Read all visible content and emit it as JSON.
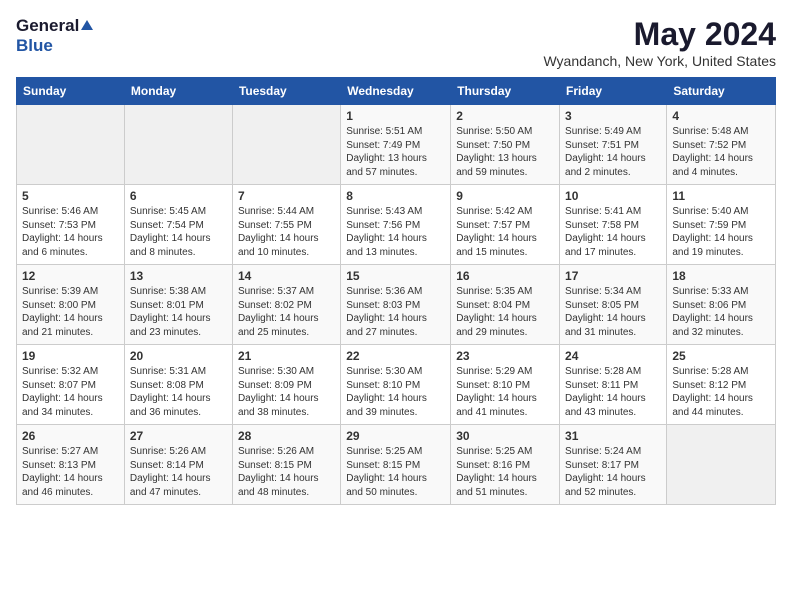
{
  "header": {
    "logo_general": "General",
    "logo_blue": "Blue",
    "month_title": "May 2024",
    "location": "Wyandanch, New York, United States"
  },
  "calendar": {
    "days_of_week": [
      "Sunday",
      "Monday",
      "Tuesday",
      "Wednesday",
      "Thursday",
      "Friday",
      "Saturday"
    ],
    "weeks": [
      [
        {
          "day": "",
          "content": ""
        },
        {
          "day": "",
          "content": ""
        },
        {
          "day": "",
          "content": ""
        },
        {
          "day": "1",
          "content": "Sunrise: 5:51 AM\nSunset: 7:49 PM\nDaylight: 13 hours\nand 57 minutes."
        },
        {
          "day": "2",
          "content": "Sunrise: 5:50 AM\nSunset: 7:50 PM\nDaylight: 13 hours\nand 59 minutes."
        },
        {
          "day": "3",
          "content": "Sunrise: 5:49 AM\nSunset: 7:51 PM\nDaylight: 14 hours\nand 2 minutes."
        },
        {
          "day": "4",
          "content": "Sunrise: 5:48 AM\nSunset: 7:52 PM\nDaylight: 14 hours\nand 4 minutes."
        }
      ],
      [
        {
          "day": "5",
          "content": "Sunrise: 5:46 AM\nSunset: 7:53 PM\nDaylight: 14 hours\nand 6 minutes."
        },
        {
          "day": "6",
          "content": "Sunrise: 5:45 AM\nSunset: 7:54 PM\nDaylight: 14 hours\nand 8 minutes."
        },
        {
          "day": "7",
          "content": "Sunrise: 5:44 AM\nSunset: 7:55 PM\nDaylight: 14 hours\nand 10 minutes."
        },
        {
          "day": "8",
          "content": "Sunrise: 5:43 AM\nSunset: 7:56 PM\nDaylight: 14 hours\nand 13 minutes."
        },
        {
          "day": "9",
          "content": "Sunrise: 5:42 AM\nSunset: 7:57 PM\nDaylight: 14 hours\nand 15 minutes."
        },
        {
          "day": "10",
          "content": "Sunrise: 5:41 AM\nSunset: 7:58 PM\nDaylight: 14 hours\nand 17 minutes."
        },
        {
          "day": "11",
          "content": "Sunrise: 5:40 AM\nSunset: 7:59 PM\nDaylight: 14 hours\nand 19 minutes."
        }
      ],
      [
        {
          "day": "12",
          "content": "Sunrise: 5:39 AM\nSunset: 8:00 PM\nDaylight: 14 hours\nand 21 minutes."
        },
        {
          "day": "13",
          "content": "Sunrise: 5:38 AM\nSunset: 8:01 PM\nDaylight: 14 hours\nand 23 minutes."
        },
        {
          "day": "14",
          "content": "Sunrise: 5:37 AM\nSunset: 8:02 PM\nDaylight: 14 hours\nand 25 minutes."
        },
        {
          "day": "15",
          "content": "Sunrise: 5:36 AM\nSunset: 8:03 PM\nDaylight: 14 hours\nand 27 minutes."
        },
        {
          "day": "16",
          "content": "Sunrise: 5:35 AM\nSunset: 8:04 PM\nDaylight: 14 hours\nand 29 minutes."
        },
        {
          "day": "17",
          "content": "Sunrise: 5:34 AM\nSunset: 8:05 PM\nDaylight: 14 hours\nand 31 minutes."
        },
        {
          "day": "18",
          "content": "Sunrise: 5:33 AM\nSunset: 8:06 PM\nDaylight: 14 hours\nand 32 minutes."
        }
      ],
      [
        {
          "day": "19",
          "content": "Sunrise: 5:32 AM\nSunset: 8:07 PM\nDaylight: 14 hours\nand 34 minutes."
        },
        {
          "day": "20",
          "content": "Sunrise: 5:31 AM\nSunset: 8:08 PM\nDaylight: 14 hours\nand 36 minutes."
        },
        {
          "day": "21",
          "content": "Sunrise: 5:30 AM\nSunset: 8:09 PM\nDaylight: 14 hours\nand 38 minutes."
        },
        {
          "day": "22",
          "content": "Sunrise: 5:30 AM\nSunset: 8:10 PM\nDaylight: 14 hours\nand 39 minutes."
        },
        {
          "day": "23",
          "content": "Sunrise: 5:29 AM\nSunset: 8:10 PM\nDaylight: 14 hours\nand 41 minutes."
        },
        {
          "day": "24",
          "content": "Sunrise: 5:28 AM\nSunset: 8:11 PM\nDaylight: 14 hours\nand 43 minutes."
        },
        {
          "day": "25",
          "content": "Sunrise: 5:28 AM\nSunset: 8:12 PM\nDaylight: 14 hours\nand 44 minutes."
        }
      ],
      [
        {
          "day": "26",
          "content": "Sunrise: 5:27 AM\nSunset: 8:13 PM\nDaylight: 14 hours\nand 46 minutes."
        },
        {
          "day": "27",
          "content": "Sunrise: 5:26 AM\nSunset: 8:14 PM\nDaylight: 14 hours\nand 47 minutes."
        },
        {
          "day": "28",
          "content": "Sunrise: 5:26 AM\nSunset: 8:15 PM\nDaylight: 14 hours\nand 48 minutes."
        },
        {
          "day": "29",
          "content": "Sunrise: 5:25 AM\nSunset: 8:15 PM\nDaylight: 14 hours\nand 50 minutes."
        },
        {
          "day": "30",
          "content": "Sunrise: 5:25 AM\nSunset: 8:16 PM\nDaylight: 14 hours\nand 51 minutes."
        },
        {
          "day": "31",
          "content": "Sunrise: 5:24 AM\nSunset: 8:17 PM\nDaylight: 14 hours\nand 52 minutes."
        },
        {
          "day": "",
          "content": ""
        }
      ]
    ]
  }
}
